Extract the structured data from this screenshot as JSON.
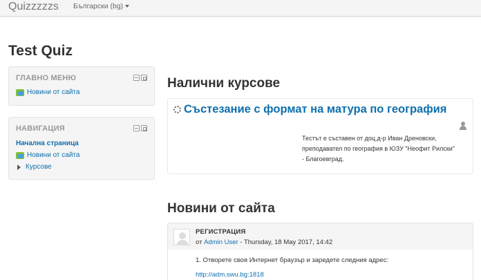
{
  "navbar": {
    "brand": "Quizzzzzs",
    "language": "Български (bg)"
  },
  "page": {
    "title": "Test Quiz"
  },
  "blocks": {
    "main_menu": {
      "title": "ГЛАВНО МЕНЮ",
      "items": [
        {
          "label": "Новини от сайта",
          "icon": "news-icon"
        }
      ]
    },
    "navigation": {
      "title": "НАВИГАЦИЯ",
      "items": [
        {
          "label": "Начална страница"
        },
        {
          "label": "Новини от сайта",
          "icon": "news-icon"
        },
        {
          "label": "Курсове",
          "icon": "expand-triangle-icon"
        }
      ]
    }
  },
  "courses": {
    "heading": "Налични курсове",
    "items": [
      {
        "title": "Състезание с формат на матура по география",
        "summary_lines": [
          "Тестът е съставен от доц.д-р Иван Дреновски,",
          "преподавател по география в ЮЗУ \"Неофит Рилски\"",
          "- Благоевград."
        ]
      }
    ]
  },
  "news": {
    "heading": "Новини от сайта",
    "post": {
      "subject": "РЕГИСТРАЦИЯ",
      "author_prefix": "от",
      "author": "Admin User",
      "date": "- Thursday, 18 May 2017, 14:42",
      "body_line": "1. Отворете своя Интернет браузър и заредете следния адрес:",
      "link": "http://adm.swu.bg:1818"
    }
  },
  "colors": {
    "link": "#0f6fad",
    "block_bg": "#f5f5f5",
    "navbar_bg": "#f5f5f5"
  }
}
